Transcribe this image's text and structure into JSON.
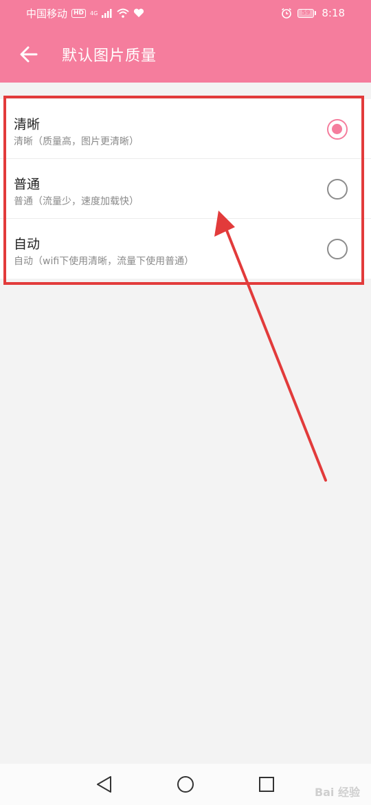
{
  "status_bar": {
    "carrier": "中国移动",
    "hd_badge": "HD",
    "network": "4G",
    "battery": "59",
    "time": "8:18"
  },
  "app_bar": {
    "title": "默认图片质量",
    "back_icon": "arrow-left-icon"
  },
  "options": [
    {
      "title": "清晰",
      "subtitle": "清晰（质量高，图片更清晰）",
      "selected": true
    },
    {
      "title": "普通",
      "subtitle": "普通（流量少，速度加载快）",
      "selected": false
    },
    {
      "title": "自动",
      "subtitle": "自动（wifi下使用清晰，流量下使用普通）",
      "selected": false
    }
  ],
  "nav_bar": {
    "back": "triangle-back-icon",
    "home": "circle-home-icon",
    "recents": "square-recents-icon"
  },
  "watermark": "Bai 经验",
  "colors": {
    "accent": "#f57d9d",
    "annotation": "#e23b3b",
    "background": "#f3f3f3"
  }
}
